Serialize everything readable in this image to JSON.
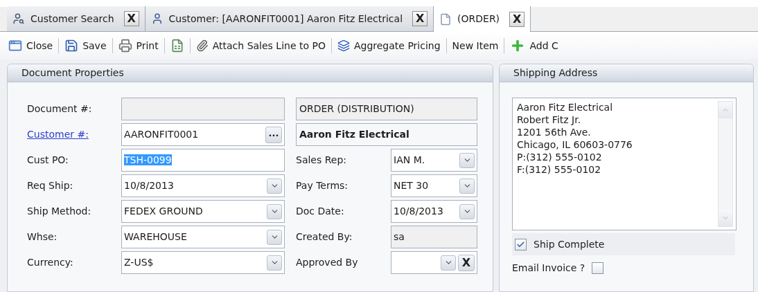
{
  "tabs": [
    {
      "label": "Customer Search",
      "kind": "search",
      "selected": false,
      "close": "X"
    },
    {
      "label": "Customer: [AARONFIT0001] Aaron Fitz Electrical",
      "kind": "customer",
      "selected": false,
      "close": "X"
    },
    {
      "label": "(ORDER)",
      "kind": "document",
      "selected": true,
      "close": "X"
    }
  ],
  "toolbar": [
    {
      "label": "Close",
      "kind": "close"
    },
    {
      "label": "Save",
      "kind": "save"
    },
    {
      "label": "Print",
      "kind": "print"
    },
    {
      "kind": "sheet"
    },
    {
      "label": "Attach Sales Line to PO",
      "kind": "attach"
    },
    {
      "label": "Aggregate Pricing",
      "kind": "aggregate"
    },
    {
      "label": "New Item",
      "kind": "text"
    },
    {
      "label": "Add C",
      "kind": "add"
    }
  ],
  "document_properties": {
    "title": "Document Properties",
    "fields": [
      {
        "label": "Document #:",
        "kind": "text",
        "readonly": true,
        "link": false,
        "highlighted": false
      },
      {
        "label": "Customer #:",
        "value": "AARONFIT0001",
        "kind": "lookup",
        "readonly": false,
        "link": true,
        "highlighted": false,
        "button": "..."
      },
      {
        "label": "Cust PO:",
        "value": "TSH-0099",
        "kind": "text",
        "readonly": false,
        "link": false,
        "highlighted": true
      },
      {
        "label": "Req Ship:",
        "value": "10/8/2013",
        "kind": "dropdown",
        "readonly": false,
        "link": false,
        "highlighted": false
      },
      {
        "label": "Ship Method:",
        "value": "FEDEX GROUND",
        "kind": "dropdown",
        "readonly": false,
        "link": false,
        "highlighted": false
      },
      {
        "label": "Whse:",
        "value": "WAREHOUSE",
        "kind": "dropdown",
        "readonly": false,
        "link": false,
        "highlighted": false
      },
      {
        "label": "Currency:",
        "value": "Z-US$",
        "kind": "dropdown",
        "readonly": false,
        "link": false,
        "highlighted": false
      }
    ],
    "document_type": "ORDER (DISTRIBUTION)",
    "customer_name": "Aaron Fitz Electrical",
    "side_fields": [
      {
        "label": "Sales Rep:",
        "value": "IAN M.",
        "kind": "dropdown",
        "readonly": false
      },
      {
        "label": "Pay Terms:",
        "value": "NET 30",
        "kind": "dropdown",
        "readonly": false
      },
      {
        "label": "Doc Date:",
        "value": "10/8/2013",
        "kind": "dropdown",
        "readonly": false
      },
      {
        "label": "Created By:",
        "value": "sa",
        "kind": "text",
        "readonly": true
      },
      {
        "label": "Approved By",
        "kind": "clearable",
        "readonly": false,
        "clear": "X"
      }
    ]
  },
  "shipping_address": {
    "title": "Shipping Address",
    "lines": [
      "Aaron Fitz Electrical",
      "Robert Fitz Jr.",
      "1201 56th Ave.",
      "Chicago, IL 60603-0776",
      "P:(312) 555-0102",
      "F:(312) 555-0102"
    ],
    "ship_complete": {
      "label": "Ship Complete",
      "checked": true
    },
    "email_invoice": {
      "label": "Email Invoice ?",
      "checked": false
    }
  }
}
